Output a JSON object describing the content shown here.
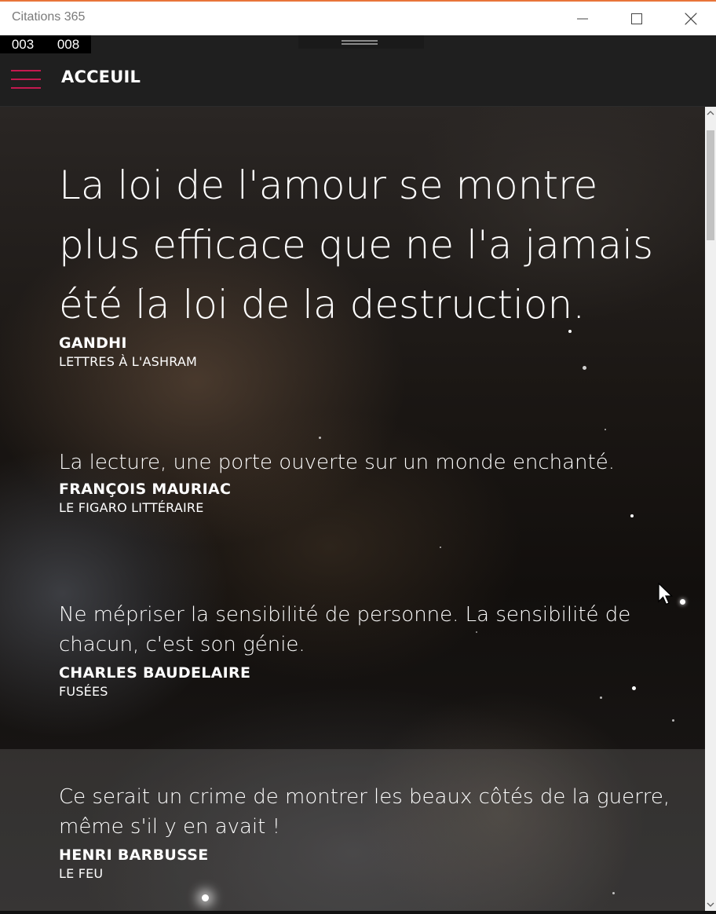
{
  "window": {
    "title": "Citations 365"
  },
  "counters": [
    "003",
    "008"
  ],
  "header": {
    "title": "ACCEUIL"
  },
  "quotes": [
    {
      "text": "La loi de l'amour se montre plus efficace que ne l'a jamais été la loi de la destruction.",
      "author": "GANDHI",
      "source": "LETTRES À L'ASHRAM"
    },
    {
      "text": "La lecture, une porte ouverte sur un monde enchanté.",
      "author": "FRANÇOIS MAURIAC",
      "source": "LE FIGARO LITTÉRAIRE"
    },
    {
      "text": "Ne mépriser la sensibilité de personne. La sensibilité de chacun, c'est son génie.",
      "author": "CHARLES BAUDELAIRE",
      "source": "FUSÉES"
    },
    {
      "text": "Ce serait un crime de montrer les beaux côtés de la guerre, même s'il y en avait !",
      "author": "HENRI BARBUSSE",
      "source": "LE FEU"
    }
  ],
  "colors": {
    "accent": "#c4194f",
    "titlebar_border": "#e8753a"
  },
  "icons": [
    "minimize-icon",
    "maximize-icon",
    "close-icon",
    "hamburger-menu-icon",
    "scroll-up-icon",
    "scroll-down-icon",
    "mouse-cursor-icon"
  ]
}
